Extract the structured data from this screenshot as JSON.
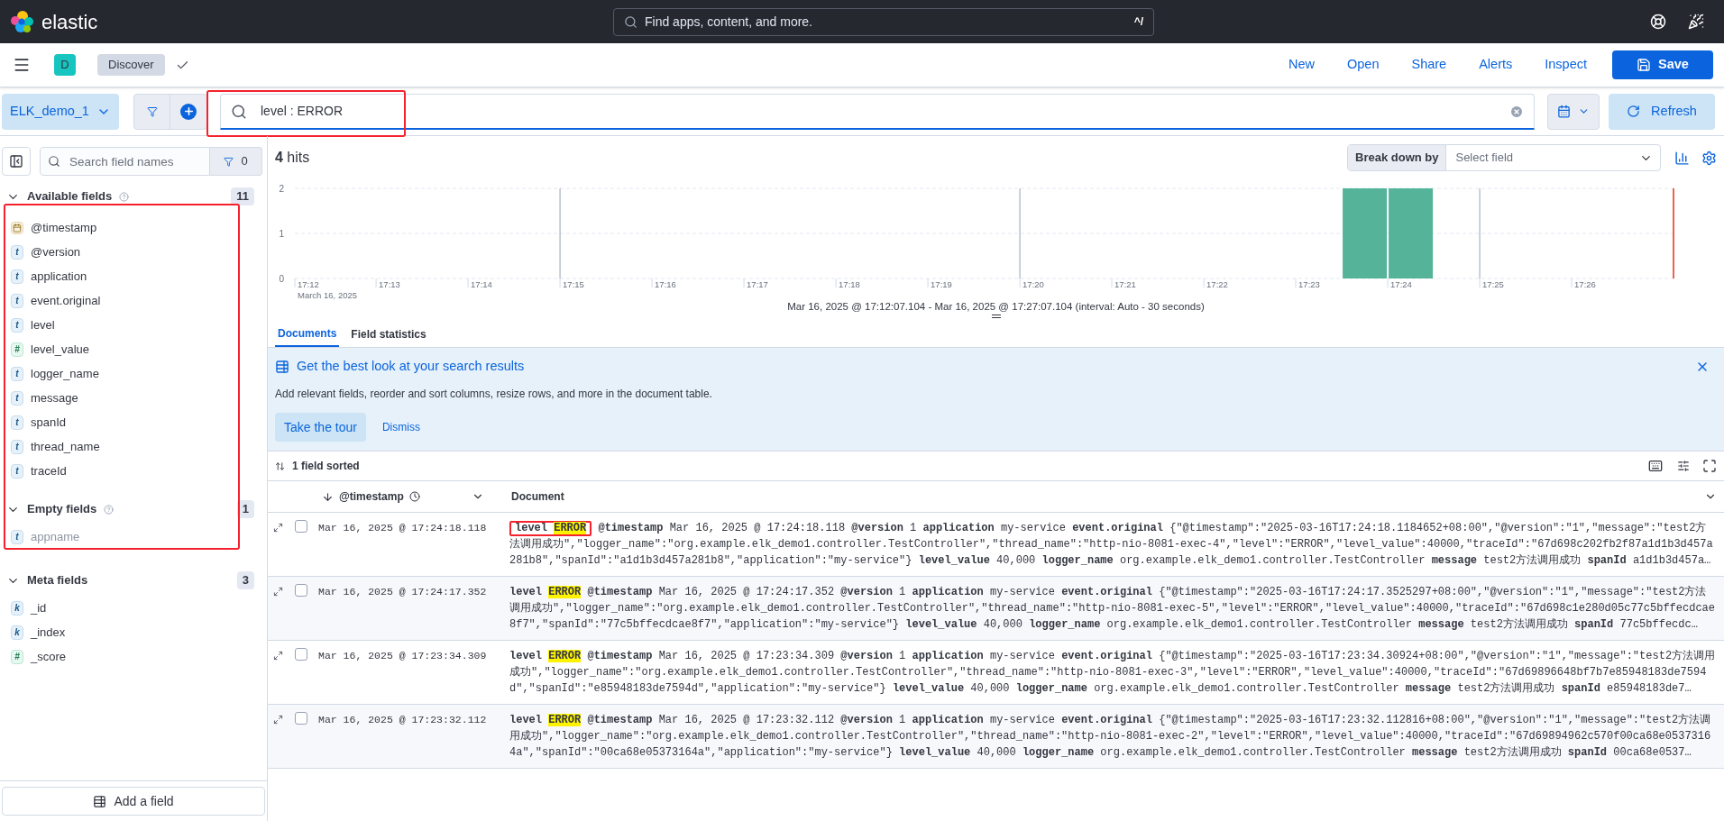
{
  "header": {
    "brand": "elastic",
    "search_placeholder": "Find apps, content, and more.",
    "shortcut": "^/"
  },
  "nav": {
    "avatar": "D",
    "breadcrumb": "Discover",
    "links": [
      "New",
      "Open",
      "Share",
      "Alerts",
      "Inspect"
    ],
    "save": "Save"
  },
  "query": {
    "data_view": "ELK_demo_1",
    "value": "level : ERROR",
    "annotated": true,
    "refresh": "Refresh"
  },
  "sidebar": {
    "search_placeholder": "Search field names",
    "filter_count": "0",
    "annotated": true,
    "add_field": "Add a field",
    "sections": [
      {
        "title": "Available fields",
        "count": "11",
        "help": true,
        "expanded": true,
        "fields": [
          {
            "name": "@timestamp",
            "kind": "date",
            "empty": false
          },
          {
            "name": "@version",
            "kind": "text",
            "token": "t",
            "empty": false
          },
          {
            "name": "application",
            "kind": "text",
            "token": "t",
            "empty": false
          },
          {
            "name": "event.original",
            "kind": "text",
            "token": "t",
            "empty": false
          },
          {
            "name": "level",
            "kind": "text",
            "token": "t",
            "empty": false
          },
          {
            "name": "level_value",
            "kind": "number",
            "token": "#",
            "empty": false
          },
          {
            "name": "logger_name",
            "kind": "text",
            "token": "t",
            "empty": false
          },
          {
            "name": "message",
            "kind": "text",
            "token": "t",
            "empty": false
          },
          {
            "name": "spanId",
            "kind": "text",
            "token": "t",
            "empty": false
          },
          {
            "name": "thread_name",
            "kind": "text",
            "token": "t",
            "empty": false
          },
          {
            "name": "traceId",
            "kind": "text",
            "token": "t",
            "empty": false
          }
        ]
      },
      {
        "title": "Empty fields",
        "count": "1",
        "help": true,
        "expanded": true,
        "fields": [
          {
            "name": "appname",
            "kind": "text",
            "token": "t",
            "empty": true
          }
        ]
      },
      {
        "title": "Meta fields",
        "count": "3",
        "help": false,
        "expanded": true,
        "fields": [
          {
            "name": "_id",
            "kind": "keyword",
            "token": "k",
            "empty": false
          },
          {
            "name": "_index",
            "kind": "keyword",
            "token": "k",
            "empty": false
          },
          {
            "name": "_score",
            "kind": "number",
            "token": "#",
            "empty": false
          }
        ]
      }
    ]
  },
  "hits": {
    "count": "4",
    "label": "hits"
  },
  "breakdown": {
    "label": "Break down by",
    "placeholder": "Select field"
  },
  "chart_data": {
    "type": "bar",
    "xlabel": "March 16, 2025",
    "ylim": [
      0,
      2
    ],
    "yticks": [
      0,
      1,
      2
    ],
    "categories": [
      "17:12",
      null,
      "17:13",
      null,
      "17:14",
      null,
      "17:15",
      null,
      "17:16",
      null,
      "17:17",
      null,
      "17:18",
      null,
      "17:19",
      null,
      "17:20",
      null,
      "17:21",
      null,
      "17:22",
      null,
      "17:23",
      null,
      "17:24",
      null,
      "17:25",
      null,
      "17:26",
      null
    ],
    "values": [
      0,
      0,
      0,
      0,
      0,
      0,
      0,
      0,
      0,
      0,
      0,
      0,
      0,
      0,
      0,
      0,
      0,
      0,
      0,
      0,
      0,
      0,
      0,
      2,
      2,
      0,
      0,
      0,
      0,
      0
    ]
  },
  "time_range": "Mar 16, 2025 @ 17:12:07.104 - Mar 16, 2025 @ 17:27:07.104 (interval: Auto - 30 seconds)",
  "tabs": [
    {
      "label": "Documents",
      "selected": true
    },
    {
      "label": "Field statistics",
      "selected": false
    }
  ],
  "callout": {
    "title": "Get the best look at your search results",
    "text": "Add relevant fields, reorder and sort columns, resize rows, and more in the document table.",
    "primary": "Take the tour",
    "secondary": "Dismiss"
  },
  "sorted": "1 field sorted",
  "columns": [
    "@timestamp",
    "Document"
  ],
  "rows": [
    {
      "checked": false,
      "annotated": true,
      "timestamp": "Mar 16, 2025 @ 17:24:18.118",
      "pairs": [
        {
          "key": "level",
          "value": "ERROR",
          "highlighted": true
        },
        {
          "key": "@timestamp",
          "value": "Mar 16, 2025 @ 17:24:18.118",
          "highlighted": false
        },
        {
          "key": "@version",
          "value": "1",
          "highlighted": false
        },
        {
          "key": "application",
          "value": "my-service",
          "highlighted": false
        },
        {
          "key": "event.original",
          "value": "{\"@timestamp\":\"2025-03-16T17:24:18.1184652+08:00\",\"@version\":\"1\",\"message\":\"test2方法调用成功\",\"logger_name\":\"org.example.elk_demo1.controller.TestController\",\"thread_name\":\"http-nio-8081-exec-4\",\"level\":\"ERROR\",\"level_value\":40000,\"traceId\":\"67d698c202fb2f87a1d1b3d457a281b8\",\"spanId\":\"a1d1b3d457a281b8\",\"application\":\"my-service\"}",
          "highlighted": false
        },
        {
          "key": "level_value",
          "value": "40,000",
          "highlighted": false
        },
        {
          "key": "logger_name",
          "value": "org.example.elk_demo1.controller.TestController",
          "highlighted": false
        },
        {
          "key": "message",
          "value": "test2方法调用成功",
          "highlighted": false
        },
        {
          "key": "spanId",
          "value": "a1d1b3d457a…",
          "highlighted": false
        }
      ]
    },
    {
      "checked": false,
      "annotated": false,
      "timestamp": "Mar 16, 2025 @ 17:24:17.352",
      "pairs": [
        {
          "key": "level",
          "value": "ERROR",
          "highlighted": true
        },
        {
          "key": "@timestamp",
          "value": "Mar 16, 2025 @ 17:24:17.352",
          "highlighted": false
        },
        {
          "key": "@version",
          "value": "1",
          "highlighted": false
        },
        {
          "key": "application",
          "value": "my-service",
          "highlighted": false
        },
        {
          "key": "event.original",
          "value": "{\"@timestamp\":\"2025-03-16T17:24:17.3525297+08:00\",\"@version\":\"1\",\"message\":\"test2方法调用成功\",\"logger_name\":\"org.example.elk_demo1.controller.TestController\",\"thread_name\":\"http-nio-8081-exec-5\",\"level\":\"ERROR\",\"level_value\":40000,\"traceId\":\"67d698c1e280d05c77c5bffecdcae8f7\",\"spanId\":\"77c5bffecdcae8f7\",\"application\":\"my-service\"}",
          "highlighted": false
        },
        {
          "key": "level_value",
          "value": "40,000",
          "highlighted": false
        },
        {
          "key": "logger_name",
          "value": "org.example.elk_demo1.controller.TestController",
          "highlighted": false
        },
        {
          "key": "message",
          "value": "test2方法调用成功",
          "highlighted": false
        },
        {
          "key": "spanId",
          "value": "77c5bffecdc…",
          "highlighted": false
        }
      ]
    },
    {
      "checked": false,
      "annotated": false,
      "timestamp": "Mar 16, 2025 @ 17:23:34.309",
      "pairs": [
        {
          "key": "level",
          "value": "ERROR",
          "highlighted": true
        },
        {
          "key": "@timestamp",
          "value": "Mar 16, 2025 @ 17:23:34.309",
          "highlighted": false
        },
        {
          "key": "@version",
          "value": "1",
          "highlighted": false
        },
        {
          "key": "application",
          "value": "my-service",
          "highlighted": false
        },
        {
          "key": "event.original",
          "value": "{\"@timestamp\":\"2025-03-16T17:23:34.30924+08:00\",\"@version\":\"1\",\"message\":\"test2方法调用成功\",\"logger_name\":\"org.example.elk_demo1.controller.TestController\",\"thread_name\":\"http-nio-8081-exec-3\",\"level\":\"ERROR\",\"level_value\":40000,\"traceId\":\"67d69896648bf7b7e85948183de7594d\",\"spanId\":\"e85948183de7594d\",\"application\":\"my-service\"}",
          "highlighted": false
        },
        {
          "key": "level_value",
          "value": "40,000",
          "highlighted": false
        },
        {
          "key": "logger_name",
          "value": "org.example.elk_demo1.controller.TestController",
          "highlighted": false
        },
        {
          "key": "message",
          "value": "test2方法调用成功",
          "highlighted": false
        },
        {
          "key": "spanId",
          "value": "e85948183de7…",
          "highlighted": false
        }
      ]
    },
    {
      "checked": false,
      "annotated": false,
      "timestamp": "Mar 16, 2025 @ 17:23:32.112",
      "pairs": [
        {
          "key": "level",
          "value": "ERROR",
          "highlighted": true
        },
        {
          "key": "@timestamp",
          "value": "Mar 16, 2025 @ 17:23:32.112",
          "highlighted": false
        },
        {
          "key": "@version",
          "value": "1",
          "highlighted": false
        },
        {
          "key": "application",
          "value": "my-service",
          "highlighted": false
        },
        {
          "key": "event.original",
          "value": "{\"@timestamp\":\"2025-03-16T17:23:32.112816+08:00\",\"@version\":\"1\",\"message\":\"test2方法调用成功\",\"logger_name\":\"org.example.elk_demo1.controller.TestController\",\"thread_name\":\"http-nio-8081-exec-2\",\"level\":\"ERROR\",\"level_value\":40000,\"traceId\":\"67d69894962c570f00ca68e05373164a\",\"spanId\":\"00ca68e05373164a\",\"application\":\"my-service\"}",
          "highlighted": false
        },
        {
          "key": "level_value",
          "value": "40,000",
          "highlighted": false
        },
        {
          "key": "logger_name",
          "value": "org.example.elk_demo1.controller.TestController",
          "highlighted": false
        },
        {
          "key": "message",
          "value": "test2方法调用成功",
          "highlighted": false
        },
        {
          "key": "spanId",
          "value": "00ca68e0537…",
          "highlighted": false
        }
      ]
    }
  ]
}
